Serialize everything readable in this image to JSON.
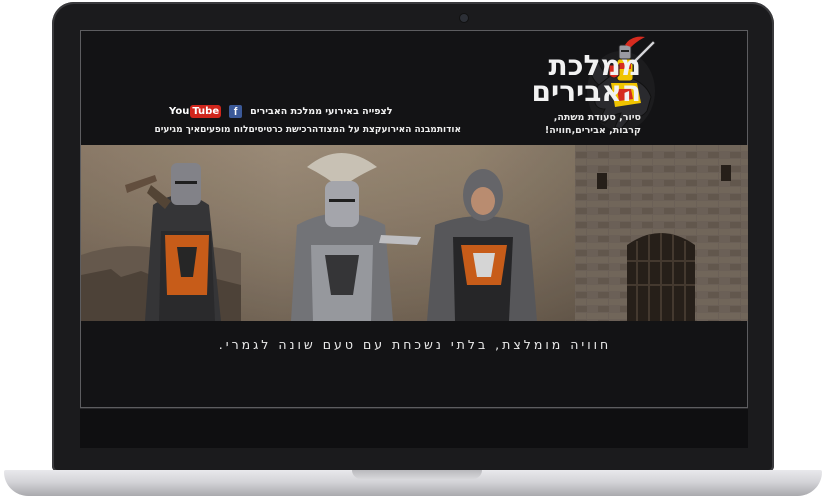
{
  "site": {
    "logo_title_line1": "ממלכת",
    "logo_title_line2": "האבירים",
    "logo_tagline_line1": "סיור, סעודת משתה,",
    "logo_tagline_line2": "קרבות, אבירים,חוויה!"
  },
  "header": {
    "youtube_you": "You",
    "youtube_tube": "Tube",
    "facebook_letter": "f",
    "social_text": "לצפייה באירועי ממלכת האבירים"
  },
  "nav": {
    "items": [
      {
        "label": "אודות"
      },
      {
        "label": "מבנה האירוע"
      },
      {
        "label": "קצת על המצודה"
      },
      {
        "label": "רכישת כרטיסים"
      },
      {
        "label": "לוח מופעים"
      },
      {
        "label": "איך מגיעים"
      }
    ]
  },
  "hero": {
    "slogan": "חוויה מומלצת, בלתי נשכחת עם טעם שונה לגמרי."
  },
  "icons": {
    "social": [
      "youtube-icon",
      "facebook-icon"
    ],
    "logo": "knight-on-horse-emblem"
  },
  "colors": {
    "background": "#131315",
    "text": "#f0f0f0",
    "youtube_red": "#d0261c",
    "facebook_blue": "#3b5998",
    "knight_orange": "#e06a1b"
  }
}
